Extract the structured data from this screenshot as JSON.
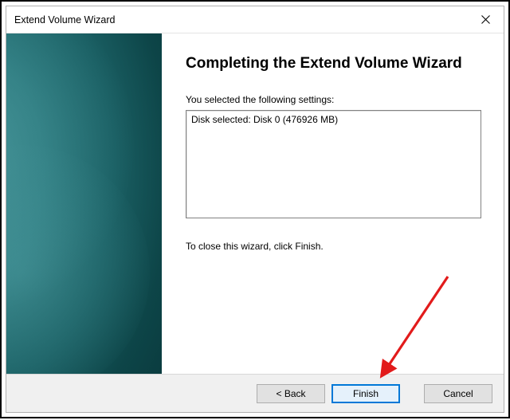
{
  "window": {
    "title": "Extend Volume Wizard"
  },
  "main": {
    "heading": "Completing the Extend Volume Wizard",
    "settings_label": "You selected the following settings:",
    "settings_lines": [
      "Disk selected: Disk 0 (476926 MB)"
    ],
    "close_instruction": "To close this wizard, click Finish."
  },
  "buttons": {
    "back": "< Back",
    "finish": "Finish",
    "cancel": "Cancel"
  }
}
